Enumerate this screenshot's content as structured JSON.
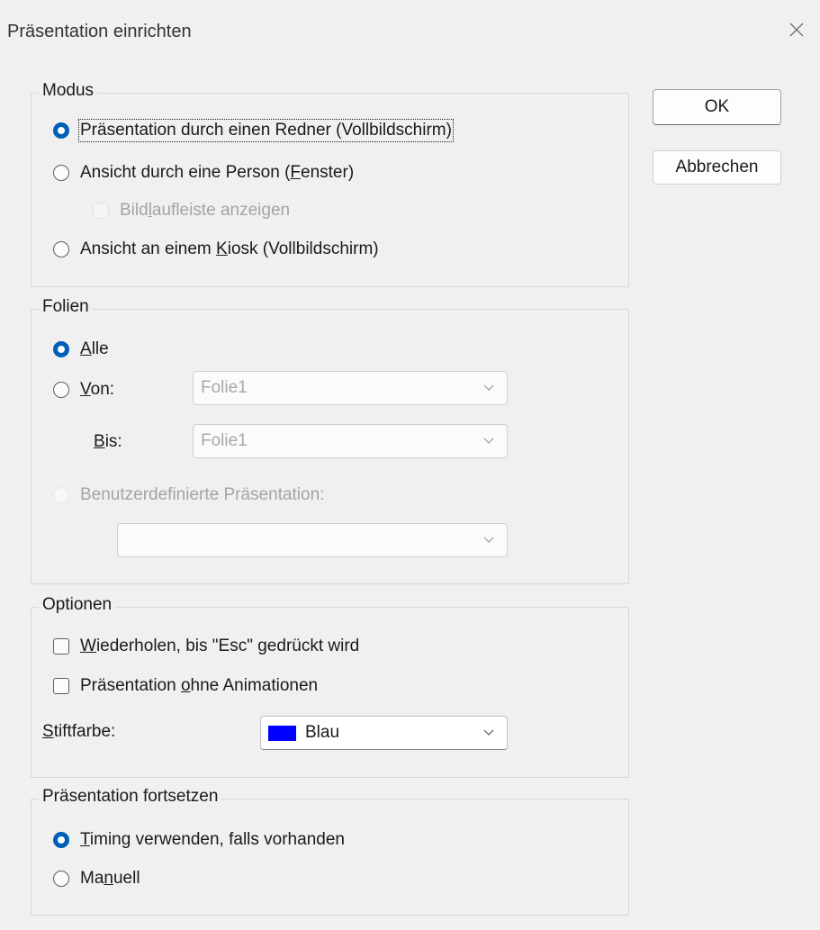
{
  "window": {
    "title": "Präsentation einrichten"
  },
  "buttons": {
    "ok": "OK",
    "cancel": "Abbrechen"
  },
  "modus": {
    "legend": "Modus",
    "speaker": "Präsentation durch einen Redner (Vollbildschirm)",
    "person_prefix": "Ansicht durch eine Person (",
    "person_u": "F",
    "person_suffix": "enster)",
    "scroll_prefix": "Bild",
    "scroll_u": "l",
    "scroll_suffix": "aufleiste anzeigen",
    "kiosk_prefix": "Ansicht an einem ",
    "kiosk_u": "K",
    "kiosk_suffix": "iosk (Vollbildschirm)"
  },
  "folien": {
    "legend": "Folien",
    "all_u": "A",
    "all_rest": "lle",
    "from_u": "V",
    "from_rest": "on:",
    "from_value": "Folie1",
    "to_u": "B",
    "to_rest": "is:",
    "to_value": "Folie1",
    "custom": "Benutzerdefinierte Präsentation:",
    "custom_value": ""
  },
  "optionen": {
    "legend": "Optionen",
    "loop_u": "W",
    "loop_rest": "iederholen, bis \"Esc\" gedrückt wird",
    "noanim_prefix": "Präsentation ",
    "noanim_u": "o",
    "noanim_suffix": "hne Animationen",
    "pen_u": "S",
    "pen_rest": "tiftfarbe:",
    "pen_value": "Blau",
    "pen_color": "#0000ff"
  },
  "fortsetzen": {
    "legend": "Präsentation fortsetzen",
    "timing_u": "T",
    "timing_rest": "iming verwenden, falls vorhanden",
    "manual_prefix": "Ma",
    "manual_u": "n",
    "manual_suffix": "uell"
  },
  "icons": {
    "close": "close-icon",
    "chevron": "chevron-down-icon"
  },
  "colors": {
    "accent": "#005fb8",
    "disabled_text": "#a4a4a4"
  }
}
